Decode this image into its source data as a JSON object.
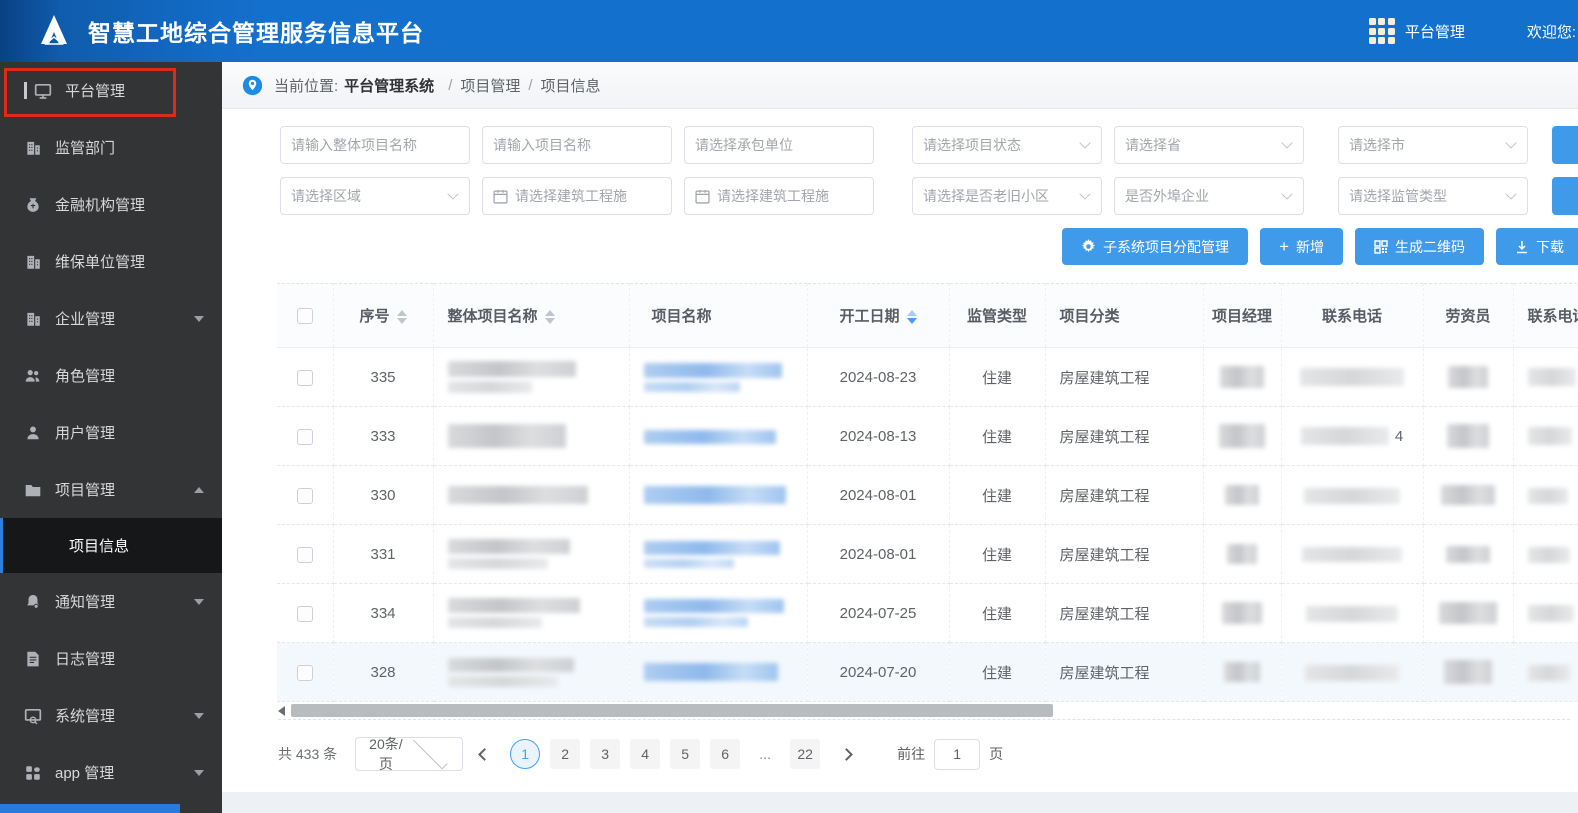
{
  "header": {
    "app_title": "智慧工地综合管理服务信息平台",
    "nav_platform_label": "平台管理",
    "welcome_label": "欢迎您:"
  },
  "sidebar": {
    "items": [
      {
        "label": "平台管理",
        "icon": "monitor-icon"
      },
      {
        "label": "监管部门",
        "icon": "building-icon"
      },
      {
        "label": "金融机构管理",
        "icon": "moneybag-icon"
      },
      {
        "label": "维保单位管理",
        "icon": "building-icon"
      },
      {
        "label": "企业管理",
        "icon": "building-icon",
        "expandable": true
      },
      {
        "label": "角色管理",
        "icon": "people-icon"
      },
      {
        "label": "用户管理",
        "icon": "user-icon"
      },
      {
        "label": "项目管理",
        "icon": "folder-icon",
        "expanded": true
      },
      {
        "label": "项目信息",
        "submenu": true,
        "active": true
      },
      {
        "label": "通知管理",
        "icon": "bell-icon",
        "expandable": true
      },
      {
        "label": "日志管理",
        "icon": "log-icon"
      },
      {
        "label": "系统管理",
        "icon": "system-icon",
        "expandable": true
      },
      {
        "label": "app 管理",
        "icon": "app-grid-icon",
        "expandable": true
      }
    ]
  },
  "breadcrumb": {
    "prefix": "当前位置:",
    "separator": "/",
    "items": [
      "平台管理系统",
      "项目管理",
      "项目信息"
    ]
  },
  "filters": {
    "row1": [
      {
        "placeholder": "请输入整体项目名称",
        "type": "text"
      },
      {
        "placeholder": "请输入项目名称",
        "type": "text"
      },
      {
        "placeholder": "请选择承包单位",
        "type": "text"
      },
      {
        "placeholder": "请选择项目状态",
        "type": "select"
      },
      {
        "placeholder": "请选择省",
        "type": "select"
      },
      {
        "placeholder": "请选择市",
        "type": "select"
      }
    ],
    "row2": [
      {
        "placeholder": "请选择区域",
        "type": "select"
      },
      {
        "placeholder": "请选择建筑工程施",
        "type": "date"
      },
      {
        "placeholder": "请选择建筑工程施",
        "type": "date"
      },
      {
        "placeholder": "请选择是否老旧小区",
        "type": "select"
      },
      {
        "placeholder": "是否外埠企业",
        "type": "select"
      },
      {
        "placeholder": "请选择监管类型",
        "type": "select"
      }
    ]
  },
  "actions": {
    "assign_label": "子系统项目分配管理",
    "add_label": "新增",
    "plus_glyph": "+",
    "qrcode_label": "生成二维码",
    "download_label": "下载"
  },
  "table": {
    "columns": {
      "seq": "序号",
      "overall_name": "整体项目名称",
      "project_name": "项目名称",
      "start_date": "开工日期",
      "supervision_type": "监管类型",
      "category": "项目分类",
      "manager": "项目经理",
      "phone": "联系电话",
      "labor_officer": "劳资员",
      "phone2": "联系电话"
    },
    "rows": [
      {
        "seq": "335",
        "start_date": "2024-08-23",
        "supervision_type": "住建",
        "category": "房屋建筑工程",
        "phone_hint": ""
      },
      {
        "seq": "333",
        "start_date": "2024-08-13",
        "supervision_type": "住建",
        "category": "房屋建筑工程",
        "phone_hint": "4"
      },
      {
        "seq": "330",
        "start_date": "2024-08-01",
        "supervision_type": "住建",
        "category": "房屋建筑工程",
        "phone_hint": ""
      },
      {
        "seq": "331",
        "start_date": "2024-08-01",
        "supervision_type": "住建",
        "category": "房屋建筑工程",
        "phone_hint": ""
      },
      {
        "seq": "334",
        "start_date": "2024-07-25",
        "supervision_type": "住建",
        "category": "房屋建筑工程",
        "phone_hint": ""
      },
      {
        "seq": "328",
        "start_date": "2024-07-20",
        "supervision_type": "住建",
        "category": "房屋建筑工程",
        "phone_hint": ""
      }
    ]
  },
  "pagination": {
    "total": "共 433 条",
    "page_size": "20条/页",
    "pages": [
      "1",
      "2",
      "3",
      "4",
      "5",
      "6",
      "...",
      "22"
    ],
    "active_page": "1",
    "goto_label": "前往",
    "goto_value": "1",
    "goto_suffix": "页"
  },
  "colors": {
    "primary": "#409EFF",
    "header_blue": "#1470cd",
    "sidebar_dark": "#323436",
    "annotation_red": "#dd2a1b",
    "button_blue": "#3f9bea"
  }
}
